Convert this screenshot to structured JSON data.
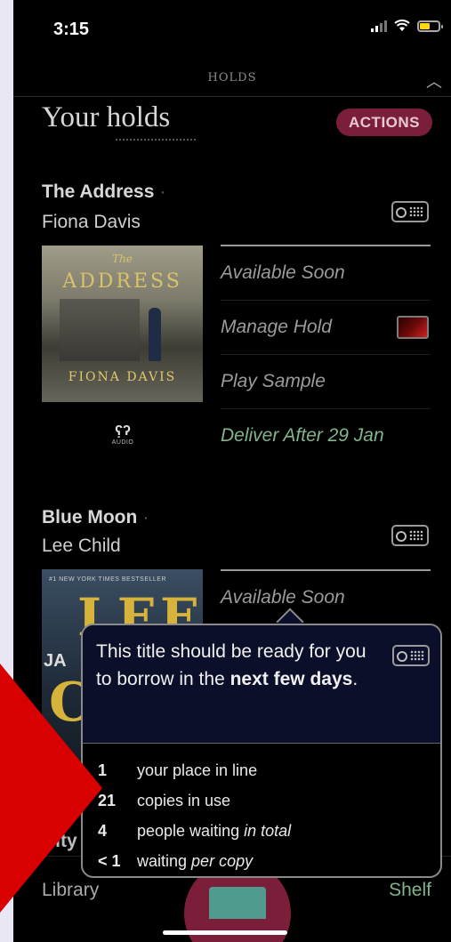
{
  "status": {
    "time": "3:15"
  },
  "header": {
    "title": "HOLDS"
  },
  "page": {
    "title": "Your holds",
    "actions_label": "ACTIONS"
  },
  "books": [
    {
      "title": "The Address",
      "author": "Fiona Davis",
      "cover": {
        "small_text": "The",
        "title": "ADDRESS",
        "author": "FIONA DAVIS"
      },
      "format": "AUDIO",
      "menu": [
        "Available Soon",
        "Manage Hold",
        "Play Sample",
        "Deliver After 29 Jan"
      ]
    },
    {
      "title": "Blue Moon",
      "author": "Lee Child",
      "cover": {
        "banner": "#1 NEW YORK TIMES BESTSELLER",
        "big_text": "LEE",
        "side_text": "JA",
        "letter": "C"
      },
      "menu": [
        "Available Soon"
      ]
    }
  ],
  "tooltip": {
    "message_start": "This title should be ready for you to borrow in the ",
    "message_bold": "next few days",
    "message_end": ".",
    "stats": [
      {
        "num": "1",
        "text": "your place in line",
        "italic": ""
      },
      {
        "num": "21",
        "text": "copies in use",
        "italic": ""
      },
      {
        "num": "4",
        "text": "people waiting ",
        "italic": "in total"
      },
      {
        "num": "< 1",
        "text": "waiting ",
        "italic": "per copy"
      }
    ]
  },
  "bottom": {
    "partial_text": "City",
    "tab_library": "Library",
    "tab_shelf": "Shelf"
  },
  "colors": {
    "accent": "#7a1e3a",
    "green": "#7fb48c",
    "annotation": "#d80000"
  },
  "icons": [
    "signal-icon",
    "wifi-icon",
    "battery-icon",
    "chevron-up-icon",
    "hold-status-icon",
    "manage-hold-icon",
    "audio-icon",
    "book-icon"
  ]
}
